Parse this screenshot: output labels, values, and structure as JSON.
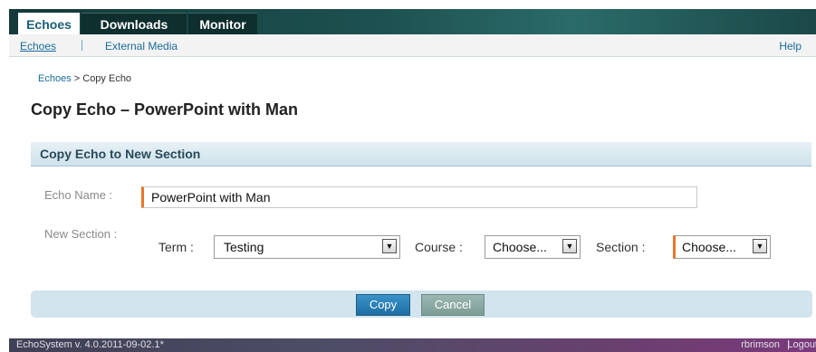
{
  "tabs": [
    {
      "label": "Echoes",
      "active": true
    },
    {
      "label": "Downloads",
      "active": false
    },
    {
      "label": "Monitor",
      "active": false
    }
  ],
  "subnav": {
    "items": [
      "Echoes",
      "External Media"
    ],
    "help": "Help"
  },
  "breadcrumb": {
    "link": "Echoes",
    "current": "> Copy Echo"
  },
  "page_title": "Copy Echo – PowerPoint with Man",
  "panel": {
    "title": "Copy Echo to New Section",
    "echo_name_label": "Echo Name :",
    "echo_name_value": "PowerPoint with Man",
    "new_section_label": "New Section :",
    "term_label": "Term :",
    "term_value": "Testing",
    "course_label": "Course :",
    "course_value": "Choose...",
    "section_label": "Section :",
    "section_value": "Choose..."
  },
  "buttons": {
    "copy": "Copy",
    "cancel": "Cancel"
  },
  "footer": {
    "version": "EchoSystem v. 4.0.2011-09-02.1*",
    "user": "rbrimson",
    "separator": "|",
    "logout": "Logout"
  },
  "colors": {
    "accent": "#1d6ea3",
    "required_marker": "#e8772a",
    "link": "#1a6b99"
  }
}
